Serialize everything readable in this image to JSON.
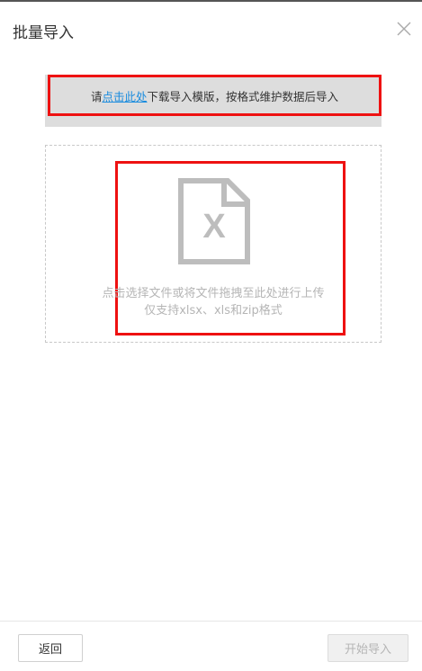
{
  "dialog": {
    "title": "批量导入",
    "close_icon": "close-icon"
  },
  "notice": {
    "prefix": "请",
    "link": "点击此处",
    "suffix": "下载导入模版，按格式维护数据后导入"
  },
  "dropzone": {
    "icon": "excel-file-icon",
    "icon_letter": "X",
    "hint_line1": "点击选择文件或将文件拖拽至此处进行上传",
    "hint_line2": "仅支持xlsx、xls和zip格式"
  },
  "footer": {
    "back_label": "返回",
    "import_label": "开始导入"
  },
  "colors": {
    "link": "#1a8cde",
    "highlight": "#ee1111",
    "notice_bg": "#dddddd",
    "disabled_text": "#b5b5b5"
  }
}
